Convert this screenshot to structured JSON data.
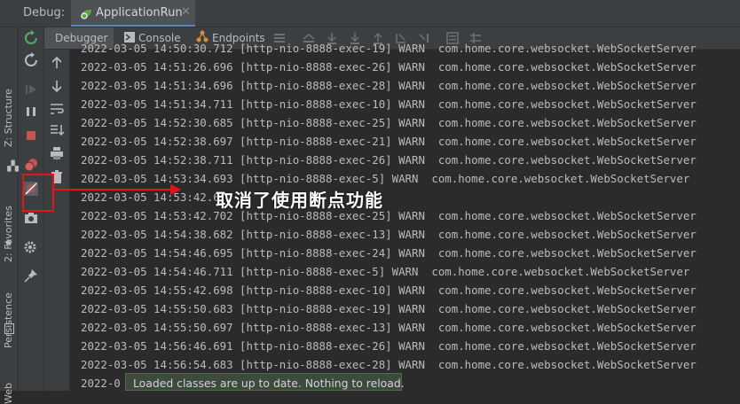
{
  "titlebar": {
    "label": "Debug:",
    "tab": "ApplicationRun"
  },
  "toolbar": {
    "tabs": [
      "Debugger",
      "Console",
      "Endpoints"
    ]
  },
  "left_strip": [
    "Z: Structure",
    "2: Favorites",
    "Persistence",
    "Web"
  ],
  "console": {
    "lines": [
      "2022-03-05 14:50:30.712 [http-nio-8888-exec-19] WARN  com.home.core.websocket.WebSocketServer",
      "2022-03-05 14:51:26.696 [http-nio-8888-exec-26] WARN  com.home.core.websocket.WebSocketServer",
      "2022-03-05 14:51:34.696 [http-nio-8888-exec-28] WARN  com.home.core.websocket.WebSocketServer",
      "2022-03-05 14:51:34.711 [http-nio-8888-exec-10] WARN  com.home.core.websocket.WebSocketServer",
      "2022-03-05 14:52:30.685 [http-nio-8888-exec-25] WARN  com.home.core.websocket.WebSocketServer",
      "2022-03-05 14:52:38.697 [http-nio-8888-exec-21] WARN  com.home.core.websocket.WebSocketServer",
      "2022-03-05 14:52:38.711 [http-nio-8888-exec-26] WARN  com.home.core.websocket.WebSocketServer",
      "2022-03-05 14:53:34.693 [http-nio-8888-exec-5] WARN  com.home.core.websocket.WebSocketServer",
      "2022-03-05 14:53:42.6",
      "2022-03-05 14:53:42.702 [http-nio-8888-exec-25] WARN  com.home.core.websocket.WebSocketServer",
      "2022-03-05 14:54:38.682 [http-nio-8888-exec-13] WARN  com.home.core.websocket.WebSocketServer",
      "2022-03-05 14:54:46.695 [http-nio-8888-exec-24] WARN  com.home.core.websocket.WebSocketServer",
      "2022-03-05 14:54:46.711 [http-nio-8888-exec-5] WARN  com.home.core.websocket.WebSocketServer",
      "2022-03-05 14:55:42.698 [http-nio-8888-exec-10] WARN  com.home.core.websocket.WebSocketServer",
      "2022-03-05 14:55:50.683 [http-nio-8888-exec-19] WARN  com.home.core.websocket.WebSocketServer",
      "2022-03-05 14:55:50.697 [http-nio-8888-exec-13] WARN  com.home.core.websocket.WebSocketServer",
      "2022-03-05 14:56:46.691 [http-nio-8888-exec-26] WARN  com.home.core.websocket.WebSocketServer",
      "2022-03-05 14:56:54.683 [http-nio-8888-exec-28] WARN  com.home.core.websocket.WebSocketServer",
      "2022-0"
    ]
  },
  "annotation": {
    "text": "取消了使用断点功能"
  },
  "toast": {
    "text": "Loaded classes are up to date. Nothing to reload."
  },
  "colors": {
    "annotation_red": "#e3151a",
    "bg": "#2b2b2b",
    "panel": "#3c3f41"
  }
}
